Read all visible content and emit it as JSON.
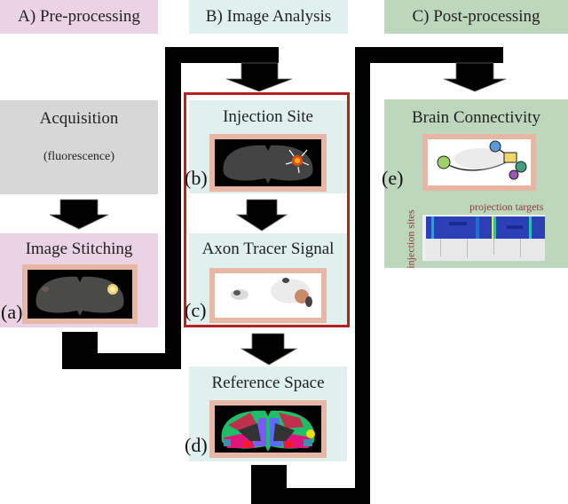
{
  "sections": {
    "pre": {
      "label": "A) Pre-processing",
      "color": "#ebd3e6"
    },
    "analysis": {
      "label": "B) Image Analysis",
      "color": "#e0f0ef"
    },
    "post": {
      "label": "C) Post-processing",
      "color": "#bcd7bc"
    }
  },
  "steps": {
    "acquisition": {
      "title": "Acquisition",
      "subtitle": "(fluorescence)",
      "color": "#d7d7d7"
    },
    "stitching": {
      "title": "Image Stitching",
      "tag": "(a)"
    },
    "injection": {
      "title": "Injection Site",
      "tag": "(b)"
    },
    "axon": {
      "title": "Axon Tracer Signal",
      "tag": "(c)"
    },
    "reference": {
      "title": "Reference Space",
      "tag": "(d)"
    },
    "connectivity": {
      "title": "Brain Connectivity",
      "tag": "(e)",
      "matrix_xlabel": "projection targets",
      "matrix_ylabel": "injection sites"
    }
  },
  "colors": {
    "highlight_box": "#b22222",
    "image_frame": "#e8b6a4",
    "label_text": "#8b3a3a"
  }
}
